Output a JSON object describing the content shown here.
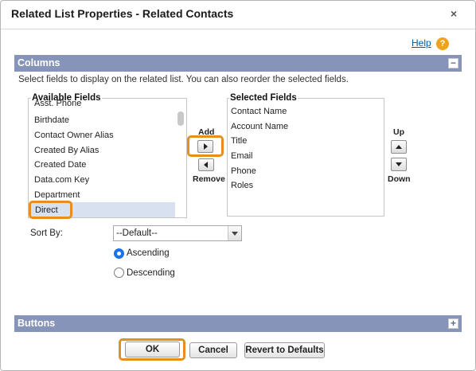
{
  "dialog": {
    "title": "Related List Properties - Related Contacts",
    "close_glyph": "×",
    "help_label": "Help",
    "help_icon": "?"
  },
  "columns_section": {
    "title": "Columns",
    "toggle_glyph": "−",
    "description": "Select fields to display on the related list. You can also reorder the selected fields."
  },
  "available_fields": {
    "title": "Available Fields",
    "items": [
      "Asst. Phone",
      "Birthdate",
      "Contact Owner Alias",
      "Created By Alias",
      "Created Date",
      "Data.com Key",
      "Department",
      "Direct"
    ],
    "selected": "Direct"
  },
  "selected_fields": {
    "title": "Selected Fields",
    "items": [
      "Contact Name",
      "Account Name",
      "Title",
      "Email",
      "Phone",
      "Roles"
    ]
  },
  "move_controls": {
    "add_label": "Add",
    "remove_label": "Remove",
    "up_label": "Up",
    "down_label": "Down"
  },
  "sort": {
    "label": "Sort By:",
    "value": "--Default--",
    "ascending_label": "Ascending",
    "descending_label": "Descending",
    "order": "ascending"
  },
  "buttons_section": {
    "title": "Buttons",
    "toggle_glyph": "+"
  },
  "footer": {
    "ok_label": "OK",
    "cancel_label": "Cancel",
    "revert_label": "Revert to Defaults"
  },
  "colors": {
    "section_bar": "#8594b8",
    "highlight": "#e58f1f",
    "link": "#015ba7",
    "help_icon": "#f0a31a",
    "selection": "#d8e1f0"
  }
}
